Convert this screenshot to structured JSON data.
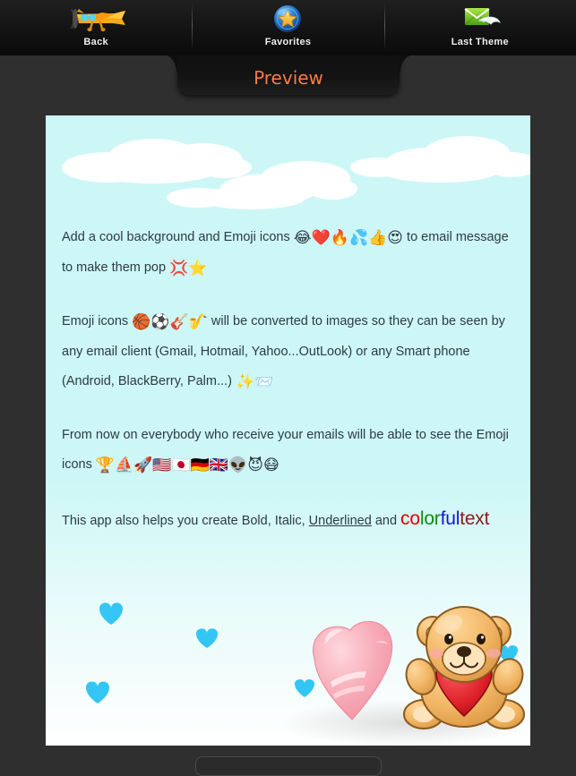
{
  "toolbar": {
    "items": [
      {
        "label": "Back",
        "icon": "airplane-icon"
      },
      {
        "label": "Favorites",
        "icon": "star-badge-icon"
      },
      {
        "label": "Last Theme",
        "icon": "winged-envelope-icon"
      }
    ]
  },
  "tab": {
    "label": "Preview"
  },
  "message": {
    "paragraphs": [
      {
        "id": "p1",
        "segments": [
          {
            "text": "Add a cool background and Emoji icons "
          },
          {
            "text": "😂❤️🔥💦👍😍",
            "type": "emoji"
          },
          {
            "text": " to email message to make them pop "
          },
          {
            "text": "💢⭐",
            "type": "emoji"
          }
        ]
      },
      {
        "id": "p2",
        "segments": [
          {
            "text": "Emoji icons "
          },
          {
            "text": "🏀⚽🎸🎷",
            "type": "emoji"
          },
          {
            "text": " will be converted to images so they can be seen by any email client (Gmail, Hotmail, Yahoo...OutLook) or any Smart phone (Android, BlackBerry, Palm...) "
          },
          {
            "text": "✨📨",
            "type": "emoji"
          }
        ]
      },
      {
        "id": "p3",
        "segments": [
          {
            "text": "From now on everybody who receive your emails will be able to see the Emoji icons "
          },
          {
            "text": "🏆⛵🚀🇺🇸🇯🇵🇩🇪🇬🇧👽😈😷",
            "type": "emoji"
          }
        ]
      },
      {
        "id": "p4",
        "prefix": "This app also helps you create Bold, Italic, ",
        "underlined": "Underlined",
        "middle": " and ",
        "colorful": [
          {
            "ch": "c",
            "color": "#e00000"
          },
          {
            "ch": "o",
            "color": "#e00000"
          },
          {
            "ch": "l",
            "color": "#108a10"
          },
          {
            "ch": "o",
            "color": "#108a10"
          },
          {
            "ch": "r",
            "color": "#108a10"
          },
          {
            "ch": "f",
            "color": "#1414e0"
          },
          {
            "ch": "u",
            "color": "#1414e0"
          },
          {
            "ch": "l",
            "color": "#1414e0"
          }
        ],
        "tail": "text"
      }
    ]
  },
  "artwork": {
    "description": "teddy-bear-with-heart",
    "bg_top_color": "#cdf7f6",
    "bg_bottom_color": "#ffffff",
    "heart_color": "#33c6f4"
  },
  "colors": {
    "app_background": "#2f2f2f",
    "toolbar_background": "#0f0f0f",
    "panel_background": "#cdf7f6",
    "accent": "#ff7a45",
    "text": "#2c3a44"
  }
}
